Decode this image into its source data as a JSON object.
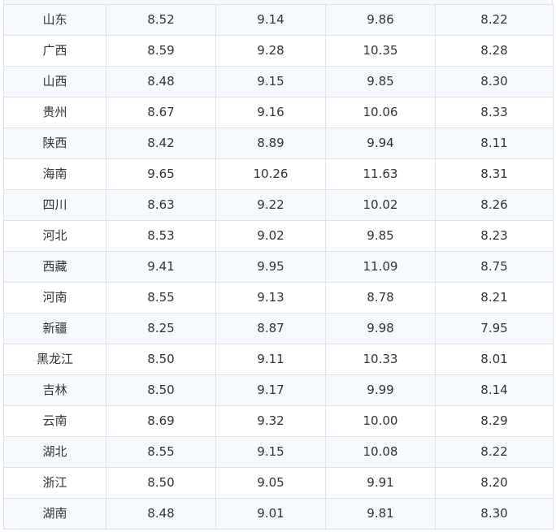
{
  "table": {
    "rows": [
      [
        "山东",
        "8.52",
        "9.14",
        "9.86",
        "8.22"
      ],
      [
        "广西",
        "8.59",
        "9.28",
        "10.35",
        "8.28"
      ],
      [
        "山西",
        "8.48",
        "9.15",
        "9.85",
        "8.30"
      ],
      [
        "贵州",
        "8.67",
        "9.16",
        "10.06",
        "8.33"
      ],
      [
        "陕西",
        "8.42",
        "8.89",
        "9.94",
        "8.11"
      ],
      [
        "海南",
        "9.65",
        "10.26",
        "11.63",
        "8.31"
      ],
      [
        "四川",
        "8.63",
        "9.22",
        "10.02",
        "8.26"
      ],
      [
        "河北",
        "8.53",
        "9.02",
        "9.85",
        "8.23"
      ],
      [
        "西藏",
        "9.41",
        "9.95",
        "11.09",
        "8.75"
      ],
      [
        "河南",
        "8.55",
        "9.13",
        "8.78",
        "8.21"
      ],
      [
        "新疆",
        "8.25",
        "8.87",
        "9.98",
        "7.95"
      ],
      [
        "黑龙江",
        "8.50",
        "9.11",
        "10.33",
        "8.01"
      ],
      [
        "吉林",
        "8.50",
        "9.17",
        "9.99",
        "8.14"
      ],
      [
        "云南",
        "8.69",
        "9.32",
        "10.00",
        "8.29"
      ],
      [
        "湖北",
        "8.55",
        "9.15",
        "10.08",
        "8.22"
      ],
      [
        "浙江",
        "8.50",
        "9.05",
        "9.91",
        "8.20"
      ],
      [
        "湖南",
        "8.48",
        "9.01",
        "9.81",
        "8.30"
      ]
    ]
  }
}
